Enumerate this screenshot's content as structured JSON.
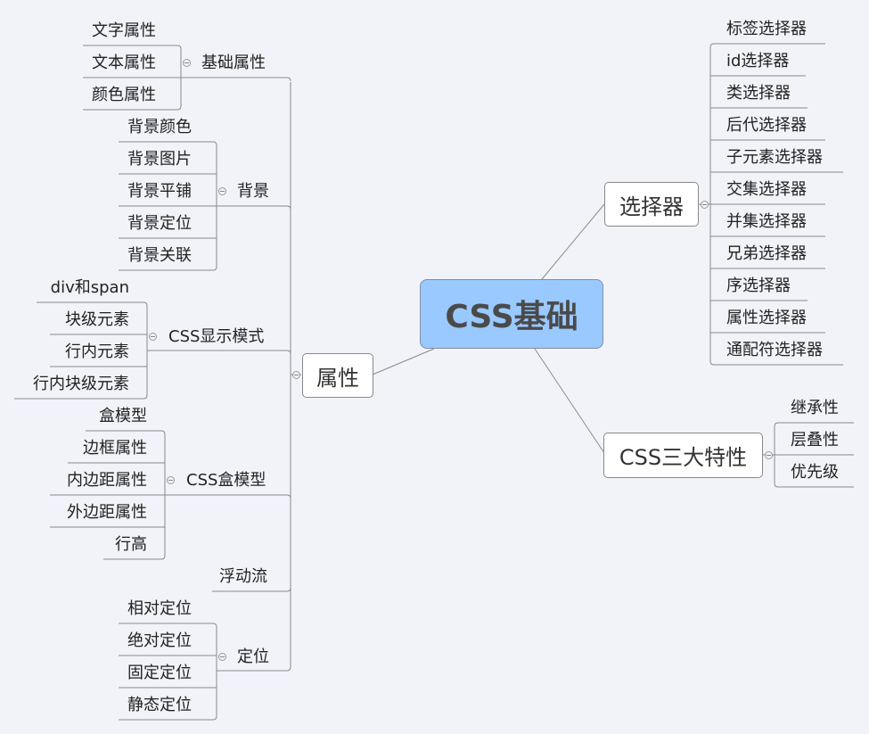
{
  "root": {
    "label": "CSS基础",
    "fill": "#99c9ff"
  },
  "left": {
    "topic": "属性",
    "groups": [
      {
        "label": "基础属性",
        "children": [
          "文字属性",
          "文本属性",
          "颜色属性"
        ]
      },
      {
        "label": "背景",
        "children": [
          "背景颜色",
          "背景图片",
          "背景平铺",
          "背景定位",
          "背景关联"
        ]
      },
      {
        "label": "CSS显示模式",
        "children": [
          "div和span",
          "块级元素",
          "行内元素",
          "行内块级元素"
        ]
      },
      {
        "label": "CSS盒模型",
        "children": [
          "盒模型",
          "边框属性",
          "内边距属性",
          "外边距属性",
          "行高"
        ]
      },
      {
        "label": "浮动流",
        "children": []
      },
      {
        "label": "定位",
        "children": [
          "相对定位",
          "绝对定位",
          "固定定位",
          "静态定位"
        ]
      }
    ]
  },
  "right": [
    {
      "topic": "选择器",
      "children": [
        "标签选择器",
        "id选择器",
        "类选择器",
        "后代选择器",
        "子元素选择器",
        "交集选择器",
        "并集选择器",
        "兄弟选择器",
        "序选择器",
        "属性选择器",
        "通配符选择器"
      ]
    },
    {
      "topic": "CSS三大特性",
      "children": [
        "继承性",
        "层叠性",
        "优先级"
      ]
    }
  ],
  "colors": {
    "background": "#f2f3f9",
    "line": "#888888"
  }
}
